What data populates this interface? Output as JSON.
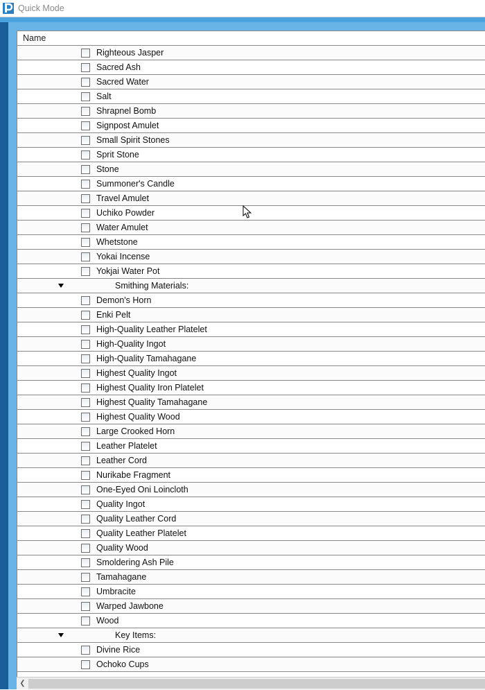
{
  "titlebar": {
    "title": "Quick Mode"
  },
  "column_header": "Name",
  "groups": [
    {
      "name": null,
      "items": [
        "Righteous Jasper",
        "Sacred Ash",
        "Sacred Water",
        "Salt",
        "Shrapnel Bomb",
        "Signpost Amulet",
        "Small Spirit Stones",
        "Sprit Stone",
        "Stone",
        "Summoner's Candle",
        "Travel Amulet",
        "Uchiko Powder",
        "Water Amulet",
        "Whetstone",
        "Yokai Incense",
        "Yokjai Water Pot"
      ]
    },
    {
      "name": "Smithing Materials:",
      "items": [
        "Demon's Horn",
        "Enki Pelt",
        "High-Quality Leather Platelet",
        "High-Quality Ingot",
        "High-Quality Tamahagane",
        "Highest Quality Ingot",
        "Highest Quality Iron Platelet",
        "Highest Quality Tamahagane",
        "Highest Quality Wood",
        "Large Crooked Horn",
        "Leather Platelet",
        "Leather Cord",
        "Nurikabe Fragment",
        "One-Eyed Oni Loincloth",
        "Quality Ingot",
        "Quality Leather Cord",
        "Quality Leather Platelet",
        "Quality Wood",
        "Smoldering Ash Pile",
        "Tamahagane",
        "Umbracite",
        "Warped Jawbone",
        "Wood"
      ]
    },
    {
      "name": "Key Items:",
      "items": [
        "Divine Rice",
        "Ochoko Cups"
      ]
    }
  ]
}
